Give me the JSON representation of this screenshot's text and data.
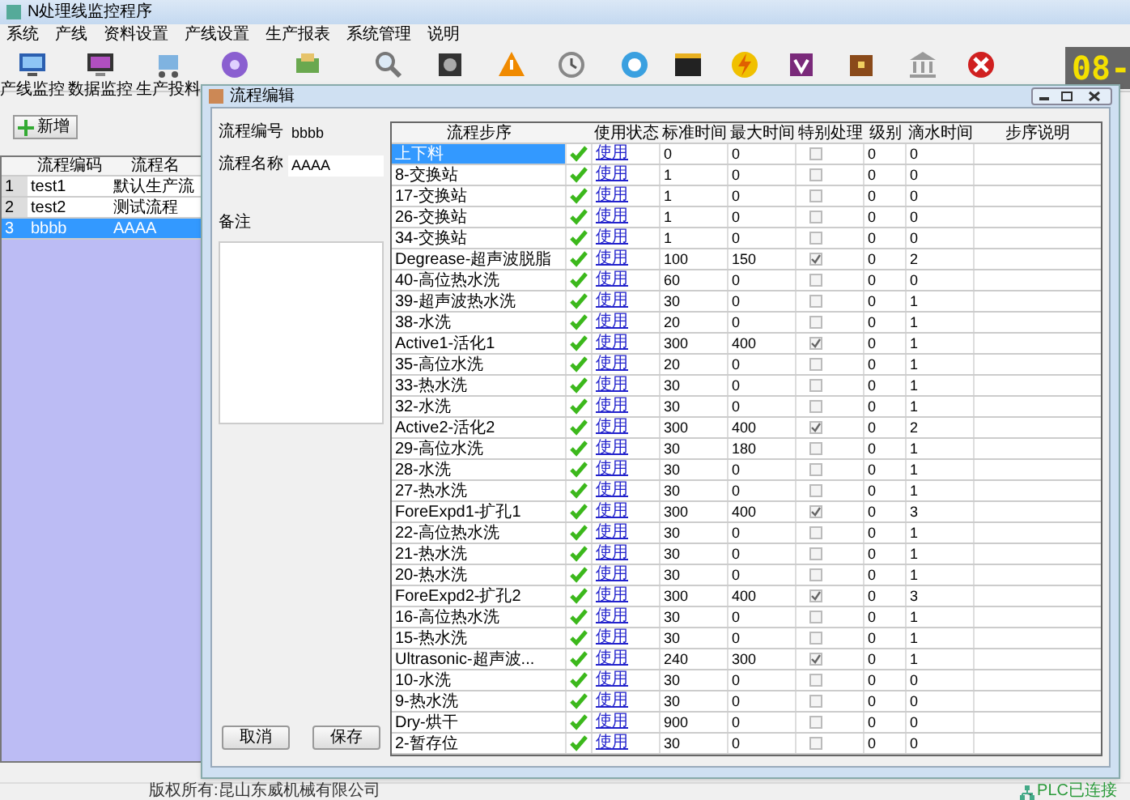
{
  "window": {
    "title": "N处理线监控程序"
  },
  "menu": [
    "系统",
    "产线",
    "资料设置",
    "产线设置",
    "生产报表",
    "系统管理",
    "说明"
  ],
  "toolbar": [
    {
      "label": "产线监控"
    },
    {
      "label": "数据监控"
    },
    {
      "label": "生产投料"
    }
  ],
  "display": "08-",
  "add_button": "新增",
  "process_table": {
    "columns": [
      "流程编码",
      "流程名"
    ],
    "rows": [
      {
        "num": "1",
        "code": "test1",
        "name": "默认生产流",
        "selected": false
      },
      {
        "num": "2",
        "code": "test2",
        "name": "测试流程",
        "selected": false
      },
      {
        "num": "3",
        "code": "bbbb",
        "name": "AAAA",
        "selected": true
      }
    ]
  },
  "dialog": {
    "title": "流程编辑",
    "fields": [
      {
        "label": "流程编号",
        "value": "bbbb",
        "kind": "readonly"
      },
      {
        "label": "流程名称",
        "value": "AAAA",
        "kind": "input"
      }
    ],
    "note_label": "备注",
    "columns": [
      "流程步序",
      "使用状态",
      "标准时间",
      "最大时间",
      "特别处理",
      "级别",
      "滴水时间",
      "步序说明"
    ],
    "rows": [
      {
        "step": "上下料",
        "selected": true,
        "enabled": true,
        "status": "使用",
        "std": "0",
        "max": "0",
        "special": false,
        "level": "0",
        "drip": "0"
      },
      {
        "step": "8-交换站",
        "selected": false,
        "enabled": true,
        "status": "使用",
        "std": "1",
        "max": "0",
        "special": false,
        "level": "0",
        "drip": "0"
      },
      {
        "step": "17-交换站",
        "selected": false,
        "enabled": true,
        "status": "使用",
        "std": "1",
        "max": "0",
        "special": false,
        "level": "0",
        "drip": "0"
      },
      {
        "step": "26-交换站",
        "selected": false,
        "enabled": true,
        "status": "使用",
        "std": "1",
        "max": "0",
        "special": false,
        "level": "0",
        "drip": "0"
      },
      {
        "step": "34-交换站",
        "selected": false,
        "enabled": true,
        "status": "使用",
        "std": "1",
        "max": "0",
        "special": false,
        "level": "0",
        "drip": "0"
      },
      {
        "step": "Degrease-超声波脱脂",
        "selected": false,
        "enabled": true,
        "status": "使用",
        "std": "100",
        "max": "150",
        "special": true,
        "level": "0",
        "drip": "2"
      },
      {
        "step": "40-高位热水洗",
        "selected": false,
        "enabled": true,
        "status": "使用",
        "std": "60",
        "max": "0",
        "special": false,
        "level": "0",
        "drip": "0"
      },
      {
        "step": "39-超声波热水洗",
        "selected": false,
        "enabled": true,
        "status": "使用",
        "std": "30",
        "max": "0",
        "special": false,
        "level": "0",
        "drip": "1"
      },
      {
        "step": "38-水洗",
        "selected": false,
        "enabled": true,
        "status": "使用",
        "std": "20",
        "max": "0",
        "special": false,
        "level": "0",
        "drip": "1"
      },
      {
        "step": "Active1-活化1",
        "selected": false,
        "enabled": true,
        "status": "使用",
        "std": "300",
        "max": "400",
        "special": true,
        "level": "0",
        "drip": "1"
      },
      {
        "step": "35-高位水洗",
        "selected": false,
        "enabled": true,
        "status": "使用",
        "std": "20",
        "max": "0",
        "special": false,
        "level": "0",
        "drip": "1"
      },
      {
        "step": "33-热水洗",
        "selected": false,
        "enabled": true,
        "status": "使用",
        "std": "30",
        "max": "0",
        "special": false,
        "level": "0",
        "drip": "1"
      },
      {
        "step": "32-水洗",
        "selected": false,
        "enabled": true,
        "status": "使用",
        "std": "30",
        "max": "0",
        "special": false,
        "level": "0",
        "drip": "1"
      },
      {
        "step": "Active2-活化2",
        "selected": false,
        "enabled": true,
        "status": "使用",
        "std": "300",
        "max": "400",
        "special": true,
        "level": "0",
        "drip": "2"
      },
      {
        "step": "29-高位水洗",
        "selected": false,
        "enabled": true,
        "status": "使用",
        "std": "30",
        "max": "180",
        "special": false,
        "level": "0",
        "drip": "1"
      },
      {
        "step": "28-水洗",
        "selected": false,
        "enabled": true,
        "status": "使用",
        "std": "30",
        "max": "0",
        "special": false,
        "level": "0",
        "drip": "1"
      },
      {
        "step": "27-热水洗",
        "selected": false,
        "enabled": true,
        "status": "使用",
        "std": "30",
        "max": "0",
        "special": false,
        "level": "0",
        "drip": "1"
      },
      {
        "step": "ForeExpd1-扩孔1",
        "selected": false,
        "enabled": true,
        "status": "使用",
        "std": "300",
        "max": "400",
        "special": true,
        "level": "0",
        "drip": "3"
      },
      {
        "step": "22-高位热水洗",
        "selected": false,
        "enabled": true,
        "status": "使用",
        "std": "30",
        "max": "0",
        "special": false,
        "level": "0",
        "drip": "1"
      },
      {
        "step": "21-热水洗",
        "selected": false,
        "enabled": true,
        "status": "使用",
        "std": "30",
        "max": "0",
        "special": false,
        "level": "0",
        "drip": "1"
      },
      {
        "step": "20-热水洗",
        "selected": false,
        "enabled": true,
        "status": "使用",
        "std": "30",
        "max": "0",
        "special": false,
        "level": "0",
        "drip": "1"
      },
      {
        "step": "ForeExpd2-扩孔2",
        "selected": false,
        "enabled": true,
        "status": "使用",
        "std": "300",
        "max": "400",
        "special": true,
        "level": "0",
        "drip": "3"
      },
      {
        "step": "16-高位热水洗",
        "selected": false,
        "enabled": true,
        "status": "使用",
        "std": "30",
        "max": "0",
        "special": false,
        "level": "0",
        "drip": "1"
      },
      {
        "step": "15-热水洗",
        "selected": false,
        "enabled": true,
        "status": "使用",
        "std": "30",
        "max": "0",
        "special": false,
        "level": "0",
        "drip": "1"
      },
      {
        "step": "Ultrasonic-超声波...",
        "selected": false,
        "enabled": true,
        "status": "使用",
        "std": "240",
        "max": "300",
        "special": true,
        "level": "0",
        "drip": "1"
      },
      {
        "step": "10-水洗",
        "selected": false,
        "enabled": true,
        "status": "使用",
        "std": "30",
        "max": "0",
        "special": false,
        "level": "0",
        "drip": "0"
      },
      {
        "step": "9-热水洗",
        "selected": false,
        "enabled": true,
        "status": "使用",
        "std": "30",
        "max": "0",
        "special": false,
        "level": "0",
        "drip": "0"
      },
      {
        "step": "Dry-烘干",
        "selected": false,
        "enabled": true,
        "status": "使用",
        "std": "900",
        "max": "0",
        "special": false,
        "level": "0",
        "drip": "0"
      },
      {
        "step": "2-暂存位",
        "selected": false,
        "enabled": true,
        "status": "使用",
        "std": "30",
        "max": "0",
        "special": false,
        "level": "0",
        "drip": "0"
      }
    ],
    "buttons": [
      "取消",
      "保存"
    ]
  },
  "status_bar": {
    "copyright": "版权所有:昆山东威机械有限公司",
    "plc": "PLC已连接"
  }
}
